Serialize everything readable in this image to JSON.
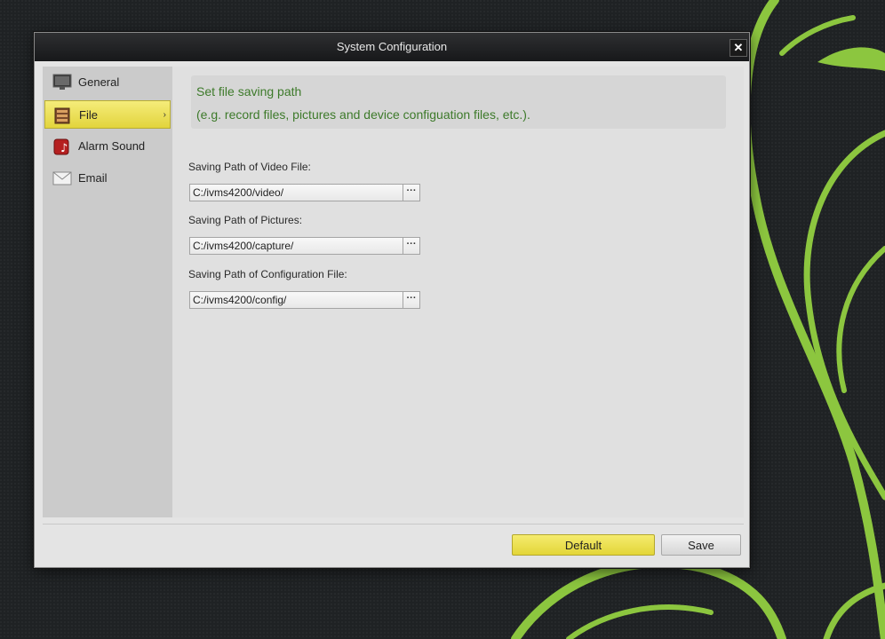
{
  "window": {
    "title": "System Configuration",
    "close_glyph": "✕"
  },
  "sidebar": {
    "items": [
      {
        "label": "General",
        "icon": "monitor-icon"
      },
      {
        "label": "File",
        "icon": "file-folder-icon",
        "active": true,
        "arrow": "›"
      },
      {
        "label": "Alarm Sound",
        "icon": "alarm-sound-icon"
      },
      {
        "label": "Email",
        "icon": "envelope-icon"
      }
    ]
  },
  "content": {
    "hint_title": "Set file saving path",
    "hint_detail": "(e.g. record files, pictures and device configuation files, etc.).",
    "fields": [
      {
        "label": "Saving Path of Video File:",
        "value": "C:/ivms4200/video/",
        "browse": "···"
      },
      {
        "label": "Saving Path of Pictures:",
        "value": "C:/ivms4200/capture/",
        "browse": "···"
      },
      {
        "label": "Saving Path of Configuration File:",
        "value": "C:/ivms4200/config/",
        "browse": "···"
      }
    ]
  },
  "footer": {
    "default_label": "Default",
    "save_label": "Save"
  },
  "colors": {
    "accent_yellow": "#e9dc4a",
    "hint_green": "#3d7a2a",
    "swirl_green": "#8cc63f"
  }
}
